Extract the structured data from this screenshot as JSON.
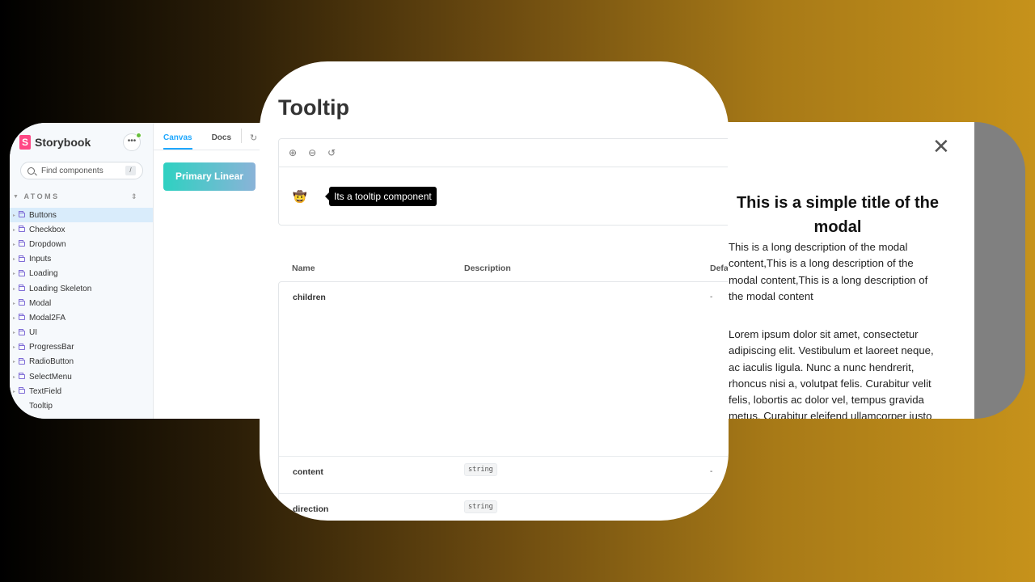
{
  "storybook": {
    "brand": "Storybook",
    "logo_letter": "S",
    "menu_label": "•••",
    "search_placeholder": "Find components",
    "search_shortcut": "/",
    "section_label": "ATOMS",
    "items": [
      {
        "label": "Buttons",
        "active": true
      },
      {
        "label": "Checkbox"
      },
      {
        "label": "Dropdown"
      },
      {
        "label": "Inputs"
      },
      {
        "label": "Loading"
      },
      {
        "label": "Loading Skeleton"
      },
      {
        "label": "Modal"
      },
      {
        "label": "Modal2FA"
      },
      {
        "label": "UI"
      },
      {
        "label": "ProgressBar"
      },
      {
        "label": "RadioButton"
      },
      {
        "label": "SelectMenu"
      },
      {
        "label": "TextField"
      },
      {
        "label": "Tooltip"
      }
    ],
    "tabs": {
      "canvas": "Canvas",
      "docs": "Docs"
    },
    "preview_button": "Primary Linear"
  },
  "doc": {
    "title": "Tooltip",
    "emoji": "🤠",
    "tooltip_text": "Its a tooltip component",
    "columns": {
      "name": "Name",
      "description": "Description",
      "default": "Defa"
    },
    "props": [
      {
        "name": "children",
        "type": "",
        "default": "-"
      },
      {
        "name": "content",
        "type": "string",
        "default": "-"
      },
      {
        "name": "direction",
        "type": "string",
        "default": ""
      }
    ]
  },
  "modal": {
    "close_label": "✕",
    "title": "This is a simple title of the modal",
    "description": "This is a long description of the modal content,This is a long description of the modal content,This is a long description of the modal content",
    "body": "Lorem ipsum dolor sit amet, consectetur adipiscing elit. Vestibulum et laoreet neque, ac iaculis ligula. Nunc a nunc hendrerit, rhoncus nisi a, volutpat felis. Curabitur velit felis, lobortis ac dolor vel, tempus gravida metus. Curabitur eleifend ullamcorper justo"
  }
}
